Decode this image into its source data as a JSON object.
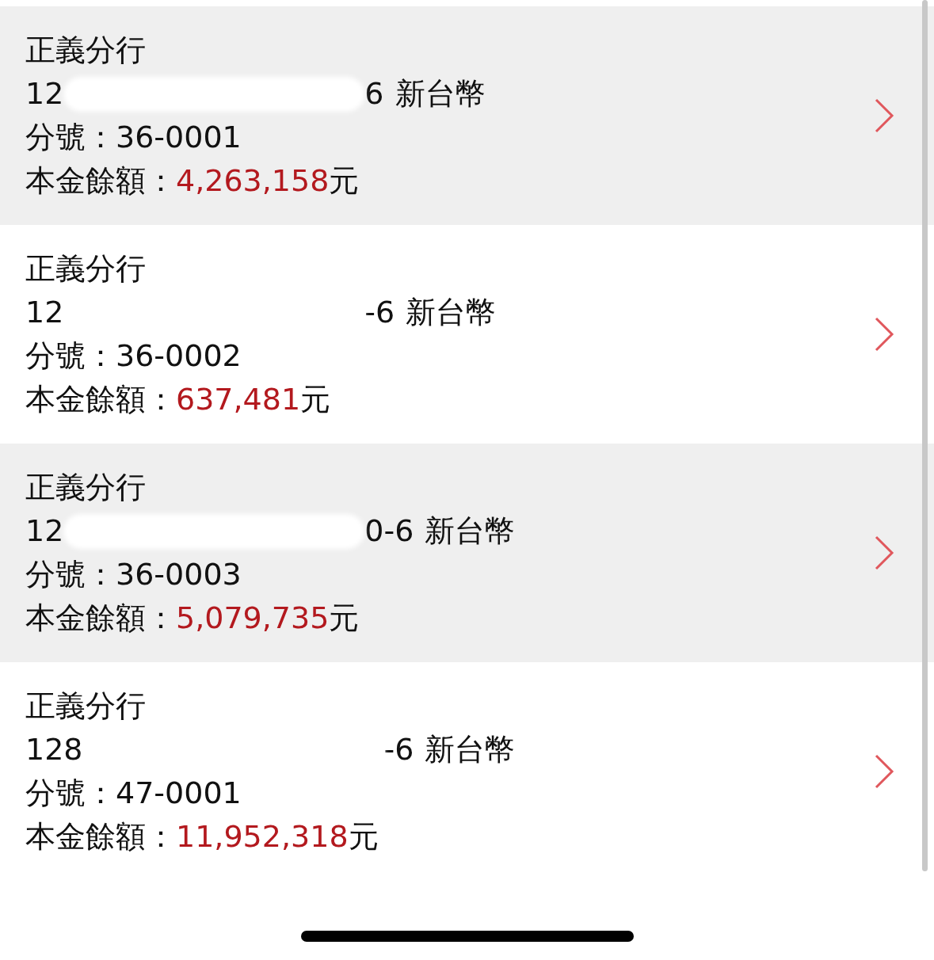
{
  "accounts": [
    {
      "branch": "正義分行",
      "number_start": "12",
      "number_end": "6",
      "currency": "新台幣",
      "sub_label": "分號：",
      "sub_number": "36-0001",
      "balance_label": "本金餘額：",
      "balance": "4,263,158",
      "unit": "元",
      "shaded": true
    },
    {
      "branch": "正義分行",
      "number_start": "12",
      "number_end": "-6",
      "currency": "新台幣",
      "sub_label": "分號：",
      "sub_number": "36-0002",
      "balance_label": "本金餘額：",
      "balance": "637,481",
      "unit": "元",
      "shaded": false
    },
    {
      "branch": "正義分行",
      "number_start": "12",
      "number_end": "0-6",
      "currency": "新台幣",
      "sub_label": "分號：",
      "sub_number": "36-0003",
      "balance_label": "本金餘額：",
      "balance": "5,079,735",
      "unit": "元",
      "shaded": true
    },
    {
      "branch": "正義分行",
      "number_start": "128",
      "number_end": "-6",
      "currency": "新台幣",
      "sub_label": "分號：",
      "sub_number": "47-0001",
      "balance_label": "本金餘額：",
      "balance": "11,952,318",
      "unit": "元",
      "shaded": false
    }
  ]
}
